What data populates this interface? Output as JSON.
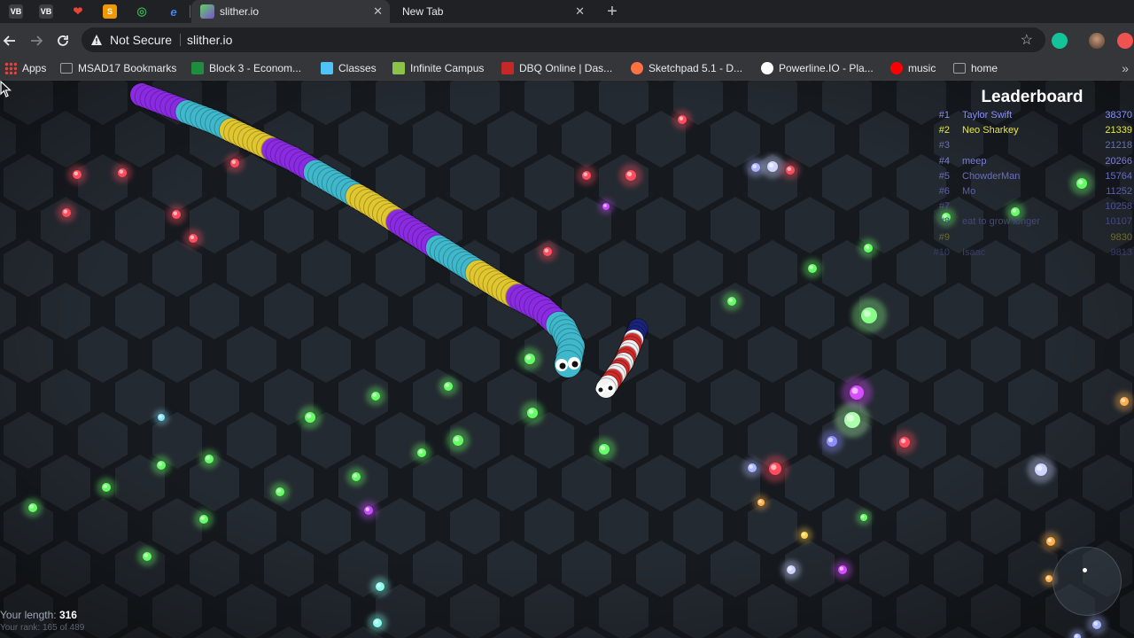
{
  "browser": {
    "pinned_tabs": [
      {
        "icon": "vb-icon",
        "text": "VB",
        "color": "#ffffff",
        "bg": "#3c4043"
      },
      {
        "icon": "vb-icon",
        "text": "VB",
        "color": "#ffffff",
        "bg": "#3c4043"
      },
      {
        "icon": "heart-icon",
        "text": "❤",
        "color": "#ea4335",
        "bg": "transparent"
      },
      {
        "icon": "s-app-icon",
        "text": "S",
        "color": "#ffffff",
        "bg": "#f29900"
      },
      {
        "icon": "compass-icon",
        "text": "◎",
        "color": "#34a853",
        "bg": "transparent"
      },
      {
        "icon": "edge-icon",
        "text": "e",
        "color": "#4285f4",
        "bg": "transparent"
      }
    ],
    "tabs": [
      {
        "title": "slither.io",
        "active": true,
        "close": "✕"
      },
      {
        "title": "New Tab",
        "active": false,
        "close": "✕"
      }
    ],
    "new_tab": "+",
    "omnibox": {
      "security": "Not Secure",
      "url": "slither.io"
    },
    "bookmarks": [
      {
        "label": "Apps",
        "icon": "apps-grid-icon",
        "color": "#ea4335"
      },
      {
        "label": "MSAD17 Bookmarks",
        "icon": "folder-icon",
        "color": "#9aa0a6"
      },
      {
        "label": "Block 3 - Econom...",
        "icon": "classroom-icon",
        "color": "#1e8e3e"
      },
      {
        "label": "Classes",
        "icon": "classes-icon",
        "color": "#4fc3f7"
      },
      {
        "label": "Infinite Campus",
        "icon": "infinite-campus-icon",
        "color": "#8bc34a"
      },
      {
        "label": "DBQ Online | Das...",
        "icon": "dbq-icon",
        "color": "#c62828"
      },
      {
        "label": "Sketchpad 5.1 - D...",
        "icon": "sketchpad-icon",
        "color": "#ff7043"
      },
      {
        "label": "Powerline.IO - Pla...",
        "icon": "powerline-icon",
        "color": "#ffffff"
      },
      {
        "label": "music",
        "icon": "youtube-music-icon",
        "color": "#ff0000"
      },
      {
        "label": "home",
        "icon": "folder-icon",
        "color": "#9aa0a6"
      }
    ],
    "more": "»"
  },
  "game": {
    "leaderboard": {
      "title": "Leaderboard",
      "entries": [
        {
          "rank": "#1",
          "name": "Taylor Swift",
          "score": "38370",
          "color": "#8a8ff0"
        },
        {
          "rank": "#2",
          "name": "Neo Sharkey",
          "score": "21339",
          "color": "#e6e84a"
        },
        {
          "rank": "#3",
          "name": "",
          "score": "21218",
          "color": "#6b6fa8"
        },
        {
          "rank": "#4",
          "name": "meep",
          "score": "20266",
          "color": "#7d7fcf"
        },
        {
          "rank": "#5",
          "name": "ChowderMan",
          "score": "15764",
          "color": "#6a6cbf"
        },
        {
          "rank": "#6",
          "name": "Mo",
          "score": "11252",
          "color": "#5c5ea8"
        },
        {
          "rank": "#7",
          "name": "",
          "score": "10258",
          "color": "#4e5090"
        },
        {
          "rank": "#8",
          "name": "eat  to grow longer",
          "score": "10107",
          "color": "#45477e"
        },
        {
          "rank": "#9",
          "name": "",
          "score": "9830",
          "color": "#6e6a2e"
        },
        {
          "rank": "#10",
          "name": "Isaac",
          "score": "9813",
          "color": "#3a3c6a"
        }
      ]
    },
    "stats": {
      "length_label": "Your length:",
      "length": "316",
      "rank_text": "Your rank: 165 of 489"
    },
    "colors": {
      "purple": "#8a2be2",
      "cyan": "#3fb8cc",
      "yellow": "#e0c62f",
      "red": "#d12b2b",
      "white": "#f2f2f2"
    }
  }
}
